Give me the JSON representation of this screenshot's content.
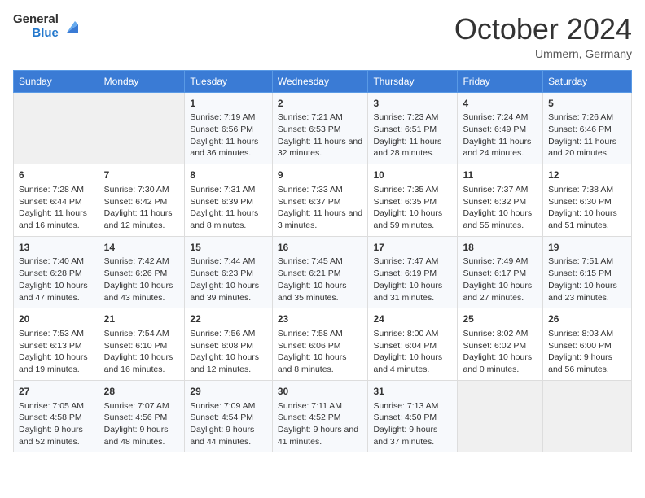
{
  "header": {
    "logo_general": "General",
    "logo_blue": "Blue",
    "month_title": "October 2024",
    "subtitle": "Ummern, Germany"
  },
  "weekdays": [
    "Sunday",
    "Monday",
    "Tuesday",
    "Wednesday",
    "Thursday",
    "Friday",
    "Saturday"
  ],
  "weeks": [
    [
      {
        "day": "",
        "info": ""
      },
      {
        "day": "",
        "info": ""
      },
      {
        "day": "1",
        "info": "Sunrise: 7:19 AM\nSunset: 6:56 PM\nDaylight: 11 hours and 36 minutes."
      },
      {
        "day": "2",
        "info": "Sunrise: 7:21 AM\nSunset: 6:53 PM\nDaylight: 11 hours and 32 minutes."
      },
      {
        "day": "3",
        "info": "Sunrise: 7:23 AM\nSunset: 6:51 PM\nDaylight: 11 hours and 28 minutes."
      },
      {
        "day": "4",
        "info": "Sunrise: 7:24 AM\nSunset: 6:49 PM\nDaylight: 11 hours and 24 minutes."
      },
      {
        "day": "5",
        "info": "Sunrise: 7:26 AM\nSunset: 6:46 PM\nDaylight: 11 hours and 20 minutes."
      }
    ],
    [
      {
        "day": "6",
        "info": "Sunrise: 7:28 AM\nSunset: 6:44 PM\nDaylight: 11 hours and 16 minutes."
      },
      {
        "day": "7",
        "info": "Sunrise: 7:30 AM\nSunset: 6:42 PM\nDaylight: 11 hours and 12 minutes."
      },
      {
        "day": "8",
        "info": "Sunrise: 7:31 AM\nSunset: 6:39 PM\nDaylight: 11 hours and 8 minutes."
      },
      {
        "day": "9",
        "info": "Sunrise: 7:33 AM\nSunset: 6:37 PM\nDaylight: 11 hours and 3 minutes."
      },
      {
        "day": "10",
        "info": "Sunrise: 7:35 AM\nSunset: 6:35 PM\nDaylight: 10 hours and 59 minutes."
      },
      {
        "day": "11",
        "info": "Sunrise: 7:37 AM\nSunset: 6:32 PM\nDaylight: 10 hours and 55 minutes."
      },
      {
        "day": "12",
        "info": "Sunrise: 7:38 AM\nSunset: 6:30 PM\nDaylight: 10 hours and 51 minutes."
      }
    ],
    [
      {
        "day": "13",
        "info": "Sunrise: 7:40 AM\nSunset: 6:28 PM\nDaylight: 10 hours and 47 minutes."
      },
      {
        "day": "14",
        "info": "Sunrise: 7:42 AM\nSunset: 6:26 PM\nDaylight: 10 hours and 43 minutes."
      },
      {
        "day": "15",
        "info": "Sunrise: 7:44 AM\nSunset: 6:23 PM\nDaylight: 10 hours and 39 minutes."
      },
      {
        "day": "16",
        "info": "Sunrise: 7:45 AM\nSunset: 6:21 PM\nDaylight: 10 hours and 35 minutes."
      },
      {
        "day": "17",
        "info": "Sunrise: 7:47 AM\nSunset: 6:19 PM\nDaylight: 10 hours and 31 minutes."
      },
      {
        "day": "18",
        "info": "Sunrise: 7:49 AM\nSunset: 6:17 PM\nDaylight: 10 hours and 27 minutes."
      },
      {
        "day": "19",
        "info": "Sunrise: 7:51 AM\nSunset: 6:15 PM\nDaylight: 10 hours and 23 minutes."
      }
    ],
    [
      {
        "day": "20",
        "info": "Sunrise: 7:53 AM\nSunset: 6:13 PM\nDaylight: 10 hours and 19 minutes."
      },
      {
        "day": "21",
        "info": "Sunrise: 7:54 AM\nSunset: 6:10 PM\nDaylight: 10 hours and 16 minutes."
      },
      {
        "day": "22",
        "info": "Sunrise: 7:56 AM\nSunset: 6:08 PM\nDaylight: 10 hours and 12 minutes."
      },
      {
        "day": "23",
        "info": "Sunrise: 7:58 AM\nSunset: 6:06 PM\nDaylight: 10 hours and 8 minutes."
      },
      {
        "day": "24",
        "info": "Sunrise: 8:00 AM\nSunset: 6:04 PM\nDaylight: 10 hours and 4 minutes."
      },
      {
        "day": "25",
        "info": "Sunrise: 8:02 AM\nSunset: 6:02 PM\nDaylight: 10 hours and 0 minutes."
      },
      {
        "day": "26",
        "info": "Sunrise: 8:03 AM\nSunset: 6:00 PM\nDaylight: 9 hours and 56 minutes."
      }
    ],
    [
      {
        "day": "27",
        "info": "Sunrise: 7:05 AM\nSunset: 4:58 PM\nDaylight: 9 hours and 52 minutes."
      },
      {
        "day": "28",
        "info": "Sunrise: 7:07 AM\nSunset: 4:56 PM\nDaylight: 9 hours and 48 minutes."
      },
      {
        "day": "29",
        "info": "Sunrise: 7:09 AM\nSunset: 4:54 PM\nDaylight: 9 hours and 44 minutes."
      },
      {
        "day": "30",
        "info": "Sunrise: 7:11 AM\nSunset: 4:52 PM\nDaylight: 9 hours and 41 minutes."
      },
      {
        "day": "31",
        "info": "Sunrise: 7:13 AM\nSunset: 4:50 PM\nDaylight: 9 hours and 37 minutes."
      },
      {
        "day": "",
        "info": ""
      },
      {
        "day": "",
        "info": ""
      }
    ]
  ]
}
